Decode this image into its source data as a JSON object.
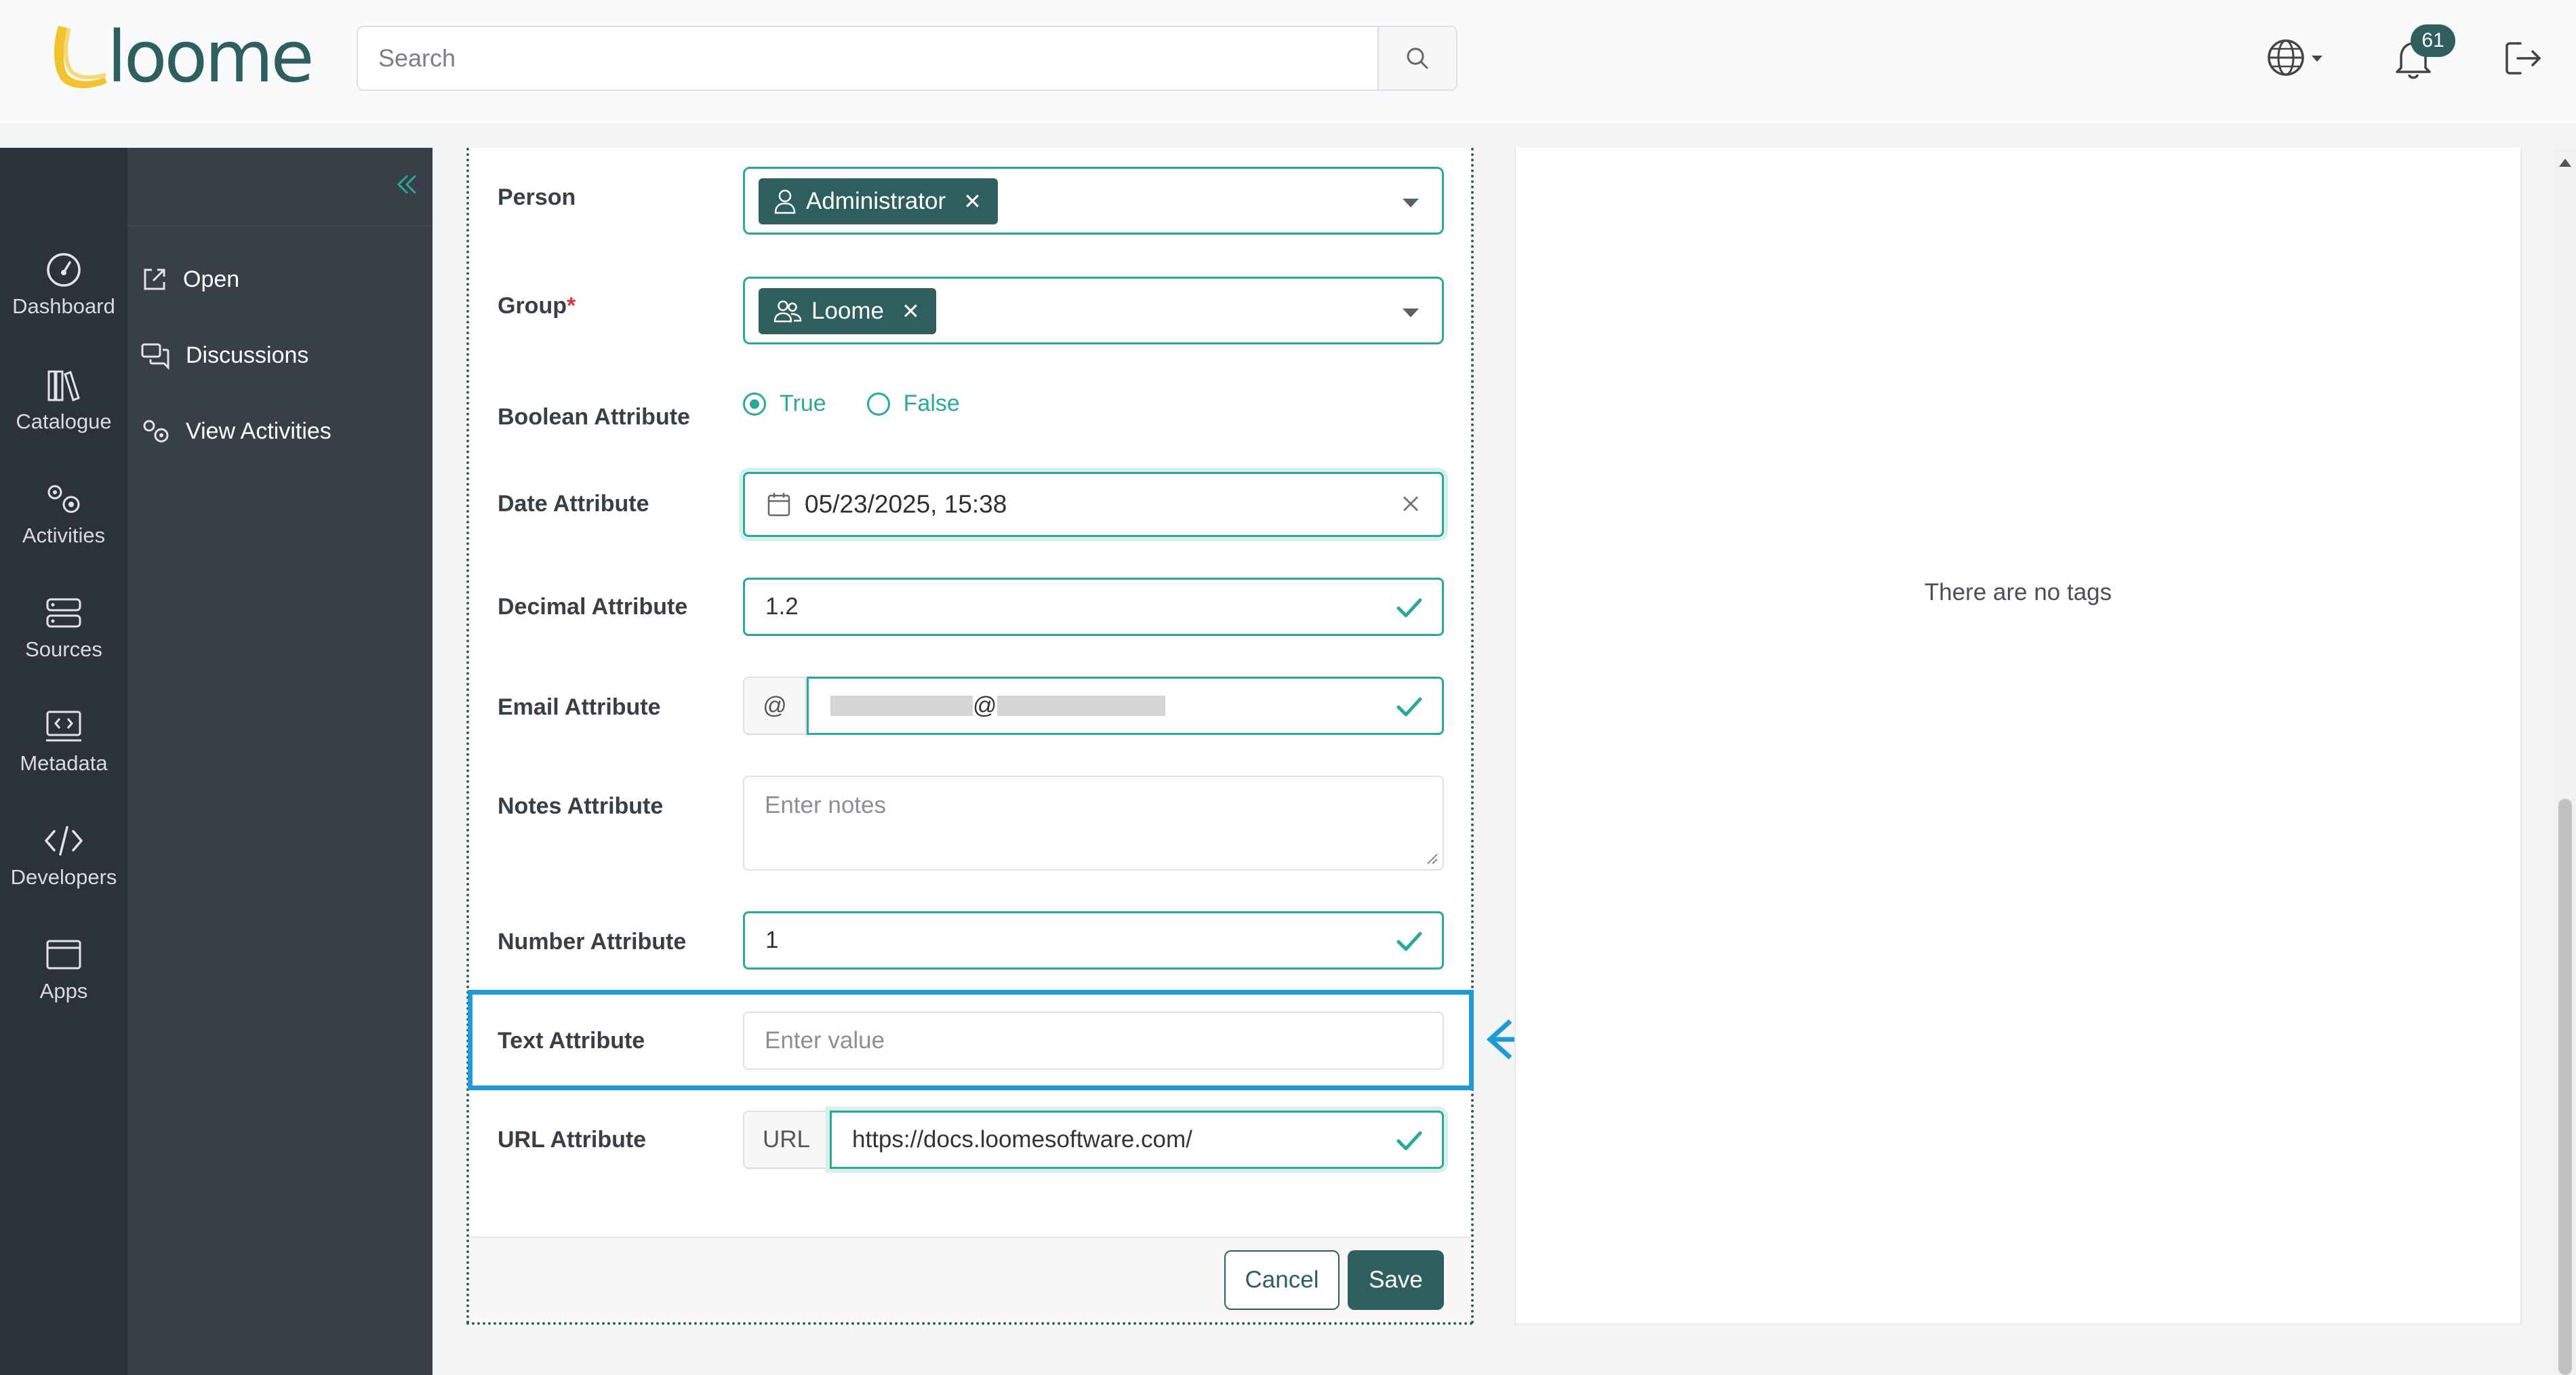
{
  "header": {
    "logo_text": "loome",
    "search_placeholder": "Search",
    "notification_count": "61"
  },
  "nav": {
    "items": [
      {
        "label": "Dashboard",
        "icon": "dashboard-icon"
      },
      {
        "label": "Catalogue",
        "icon": "catalogue-icon"
      },
      {
        "label": "Activities",
        "icon": "activities-icon"
      },
      {
        "label": "Sources",
        "icon": "sources-icon"
      },
      {
        "label": "Metadata",
        "icon": "metadata-icon"
      },
      {
        "label": "Developers",
        "icon": "developers-icon"
      },
      {
        "label": "Apps",
        "icon": "apps-icon"
      }
    ]
  },
  "subnav": {
    "items": [
      {
        "label": "Open",
        "icon": "external-link-icon"
      },
      {
        "label": "Discussions",
        "icon": "discussions-icon"
      },
      {
        "label": "View Activities",
        "icon": "activities-icon"
      }
    ]
  },
  "form": {
    "person": {
      "label": "Person",
      "value": "Administrator"
    },
    "group": {
      "label": "Group",
      "required_mark": "*",
      "value": "Loome"
    },
    "boolean": {
      "label": "Boolean Attribute",
      "options": [
        "True",
        "False"
      ],
      "selected": "True"
    },
    "date": {
      "label": "Date Attribute",
      "value": "05/23/2025, 15:38"
    },
    "decimal": {
      "label": "Decimal Attribute",
      "value": "1.2"
    },
    "email": {
      "label": "Email Attribute",
      "prefix": "@",
      "value_at": "@"
    },
    "notes": {
      "label": "Notes Attribute",
      "placeholder": "Enter notes"
    },
    "number": {
      "label": "Number Attribute",
      "value": "1"
    },
    "text": {
      "label": "Text Attribute",
      "placeholder": "Enter value"
    },
    "url": {
      "label": "URL Attribute",
      "prefix": "URL",
      "value": "https://docs.loomesoftware.com/"
    },
    "cancel_label": "Cancel",
    "save_label": "Save"
  },
  "tags_panel": {
    "empty_text": "There are no tags"
  },
  "colors": {
    "brand": "#2f5e5e",
    "accent": "#2aa898",
    "highlight": "#1e9bd7",
    "logo_yellow": "#f2c230"
  }
}
